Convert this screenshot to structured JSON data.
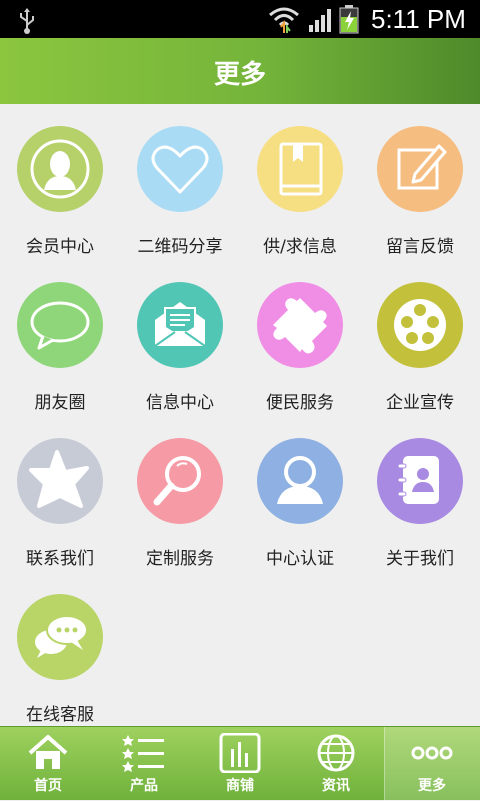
{
  "status_bar": {
    "time": "5:11 PM"
  },
  "header": {
    "title": "更多"
  },
  "grid_items": [
    {
      "label": "会员中心",
      "color": "#b6d06a",
      "icon": "member-icon"
    },
    {
      "label": "二维码分享",
      "color": "#a9dcf4",
      "icon": "heart-icon"
    },
    {
      "label": "供/求信息",
      "color": "#f6de83",
      "icon": "book-icon"
    },
    {
      "label": "留言反馈",
      "color": "#f6bd80",
      "icon": "edit-icon"
    },
    {
      "label": "朋友圈",
      "color": "#8fd67a",
      "icon": "chat-bubble-icon"
    },
    {
      "label": "信息中心",
      "color": "#52c6b4",
      "icon": "mail-icon"
    },
    {
      "label": "便民服务",
      "color": "#f08ee6",
      "icon": "puzzle-icon"
    },
    {
      "label": "企业宣传",
      "color": "#c3c13c",
      "icon": "film-reel-icon"
    },
    {
      "label": "联系我们",
      "color": "#c6cbd6",
      "icon": "star-icon"
    },
    {
      "label": "定制服务",
      "color": "#f69aa5",
      "icon": "magnifier-icon"
    },
    {
      "label": "中心认证",
      "color": "#8eb0e3",
      "icon": "user-icon"
    },
    {
      "label": "关于我们",
      "color": "#a98ae3",
      "icon": "contacts-icon"
    },
    {
      "label": "在线客服",
      "color": "#b9d567",
      "icon": "chat-icon"
    }
  ],
  "tabs": [
    {
      "label": "首页",
      "icon": "home-icon"
    },
    {
      "label": "产品",
      "icon": "list-icon"
    },
    {
      "label": "商铺",
      "icon": "shop-icon"
    },
    {
      "label": "资讯",
      "icon": "globe-icon"
    },
    {
      "label": "更多",
      "icon": "more-icon",
      "active": true
    }
  ]
}
